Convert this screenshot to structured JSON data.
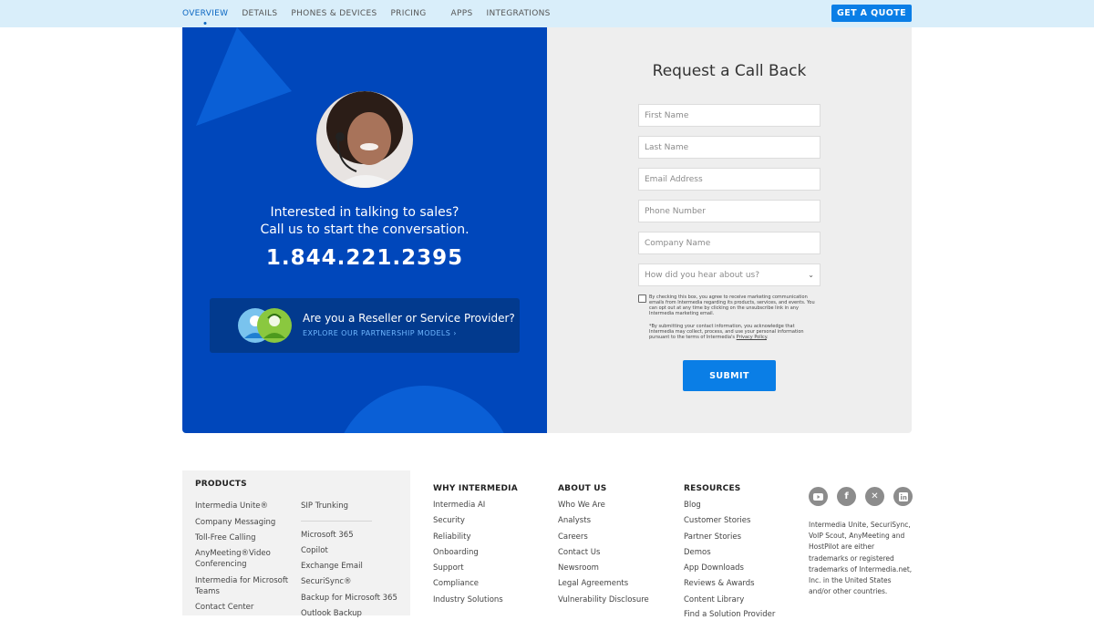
{
  "nav": {
    "links": [
      "OVERVIEW",
      "DETAILS",
      "PHONES & DEVICES",
      "PRICING",
      "APPS",
      "INTEGRATIONS"
    ],
    "cta": "GET A QUOTE",
    "accent_color": "#0a66c2"
  },
  "hero": {
    "line1": "Interested in talking to sales?",
    "line2": "Call us to start the conversation.",
    "phone": "1.844.221.2395",
    "reseller_title": "Are you a Reseller or Service Provider?",
    "reseller_link": "EXPLORE OUR PARTNERSHIP MODELS",
    "panel_color": "#0047bb"
  },
  "form": {
    "title": "Request a Call Back",
    "fields": {
      "first_name": "First Name",
      "last_name": "Last Name",
      "email": "Email Address",
      "phone": "Phone Number",
      "company": "Company Name",
      "source": "How did you hear about us?"
    },
    "consent": "By checking this box, you agree to receive marketing communication emails from Intermedia regarding its products, services, and events. You can opt out at any time by clicking on the unsubscribe link in any Intermedia marketing email.",
    "disclaimer": "*By submitting your contact information, you acknowledge that Intermedia may collect, process, and use your personal information pursuant to the terms of Intermedia's",
    "privacy_link": "Privacy Policy",
    "submit": "SUBMIT"
  },
  "footer": {
    "products": {
      "title": "PRODUCTS",
      "col1": [
        "Intermedia Unite®",
        "Company Messaging",
        "Toll-Free Calling",
        "AnyMeeting®Video Conferencing",
        "Intermedia for Microsoft Teams",
        "Contact Center"
      ],
      "col2": [
        "SIP Trunking",
        "Microsoft 365",
        "Copilot",
        "Exchange Email",
        "SecuriSync®",
        "Backup for Microsoft 365",
        "Outlook Backup"
      ]
    },
    "why": {
      "title": "WHY INTERMEDIA",
      "links": [
        "Intermedia AI",
        "Security",
        "Reliability",
        "Onboarding",
        "Support",
        "Compliance",
        "Industry Solutions"
      ]
    },
    "about": {
      "title": "ABOUT US",
      "links": [
        "Who We Are",
        "Analysts",
        "Careers",
        "Contact Us",
        "Newsroom",
        "Legal Agreements",
        "Vulnerability Disclosure"
      ]
    },
    "resources": {
      "title": "RESOURCES",
      "links": [
        "Blog",
        "Customer Stories",
        "Partner Stories",
        "Demos",
        "App Downloads",
        "Reviews & Awards",
        "Content Library",
        "Find a Solution Provider"
      ]
    },
    "social_icons": [
      "youtube-icon",
      "facebook-icon",
      "x-icon",
      "linkedin-icon"
    ],
    "trademark": "Intermedia Unite, SecuriSync, VoIP Scout, AnyMeeting and HostPilot are either trademarks or registered trademarks of Intermedia.net, Inc. in the United States and/or other countries."
  }
}
